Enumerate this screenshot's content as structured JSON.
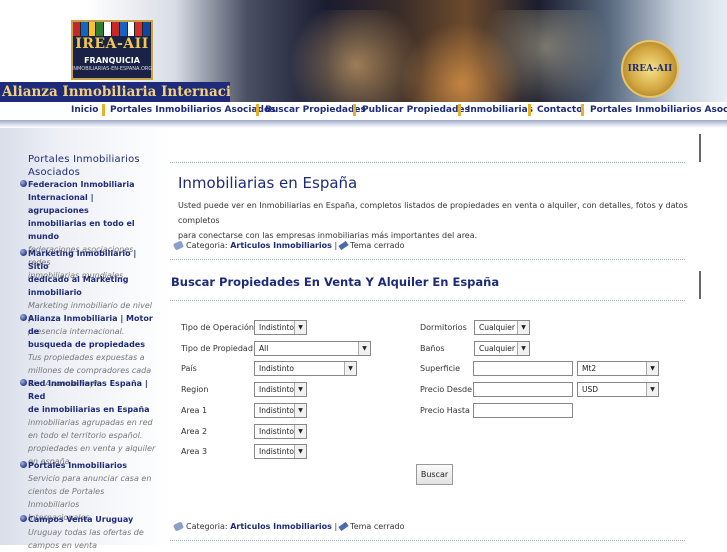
{
  "header": {
    "logo_title": "IREA-AII",
    "logo_sub": "FRANQUICIA",
    "logo_url": "INMOBILIARIAS-EN-ESPANA.ORG",
    "brand_name": "Alianza Inmobiliaria Internacional",
    "seal_text": "IREA-AII",
    "flag_colors": [
      "#c62828",
      "#1565c0",
      "#fbc02d",
      "#2e7d32",
      "#ffffff",
      "#c62828",
      "#1565c0",
      "#ffffff",
      "#d32f2f",
      "#0d47a1"
    ]
  },
  "nav": {
    "items": [
      "Inicio",
      "Portales Inmobiliarios Asociados",
      "Buscar Propiedades",
      "Publicar Propiedades",
      "Inmobiliarias",
      "Contacto",
      "Portales Inmobiliarios Asociados"
    ]
  },
  "sidebar": {
    "title_line1": "Portales Inmobiliarios",
    "title_line2": "Asociados",
    "entries": [
      {
        "link": [
          "Federacion Inmobiliaria",
          "Internacional | agrupaciones",
          "inmobiliarias en todo el mundo"
        ],
        "desc": [
          "federaciones asociaciones redes",
          "inmobiliarias mundiales"
        ]
      },
      {
        "link": [
          "Marketing Inmobiliario | Sitio",
          "dedicado al Marketing",
          "inmobiliario"
        ],
        "desc": [
          "Marketing inmobiliario de nivel y",
          "presencia internacional."
        ]
      },
      {
        "link": [
          "Alianza Inmobiliaria | Motor de",
          "busqueda de propiedades"
        ],
        "desc": [
          "Tus propiedades expuestas a",
          "millones de compradores cada",
          "dia. Anuncia hoy!"
        ]
      },
      {
        "link": [
          "Red Inmobiliarias España | Red",
          "de inmobiliarias en España"
        ],
        "desc": [
          "inmobiliarias agrupadas en red",
          "en todo el territorio español.",
          "propiedades en venta y alquiler",
          "en españa"
        ]
      },
      {
        "link": [
          "Portales Inmobiliarios"
        ],
        "desc": [
          "Servicio para anunciar casa en",
          "cientos de Portales Inmobiliarios",
          "Internacionales"
        ]
      },
      {
        "link": [
          "Campos Venta Uruguay"
        ],
        "desc": [
          "Uruguay todas las ofertas de",
          "campos en venta"
        ]
      }
    ]
  },
  "main": {
    "title": "Inmobiliarias en España",
    "intro_line1": "Usted puede ver en Inmobiliarias en España, completos listados de propiedades en venta o alquiler, con detalles, fotos y datos completos",
    "intro_line2": "para conectarse con las empresas inmobiliarias más importantes del area.",
    "meta_label": "Categoria:",
    "meta_link": "Articulos Inmobiliarios",
    "meta_sep": "|",
    "meta_closed": "Tema cerrado"
  },
  "search": {
    "title": "Buscar Propiedades En Venta Y Alquiler En España",
    "left": [
      {
        "label": "Tipo de Operación",
        "value": "Indistinto"
      },
      {
        "label": "Tipo de Propiedad",
        "value": "All"
      },
      {
        "label": "País",
        "value": "Indistinto"
      },
      {
        "label": "Region",
        "value": "Indistinto"
      },
      {
        "label": "Area 1",
        "value": "Indistinto"
      },
      {
        "label": "Area 2",
        "value": "Indistinto"
      },
      {
        "label": "Area 3",
        "value": "Indistinto"
      }
    ],
    "right": [
      {
        "label": "Dormitorios",
        "value": "Cualquier"
      },
      {
        "label": "Baños",
        "value": "Cualquier"
      },
      {
        "label": "Superficie",
        "value": "",
        "unit": "Mt2"
      },
      {
        "label": "Precio Desde",
        "value": "",
        "unit": "USD"
      },
      {
        "label": "Precio Hasta",
        "value": ""
      }
    ],
    "submit": "Buscar"
  }
}
